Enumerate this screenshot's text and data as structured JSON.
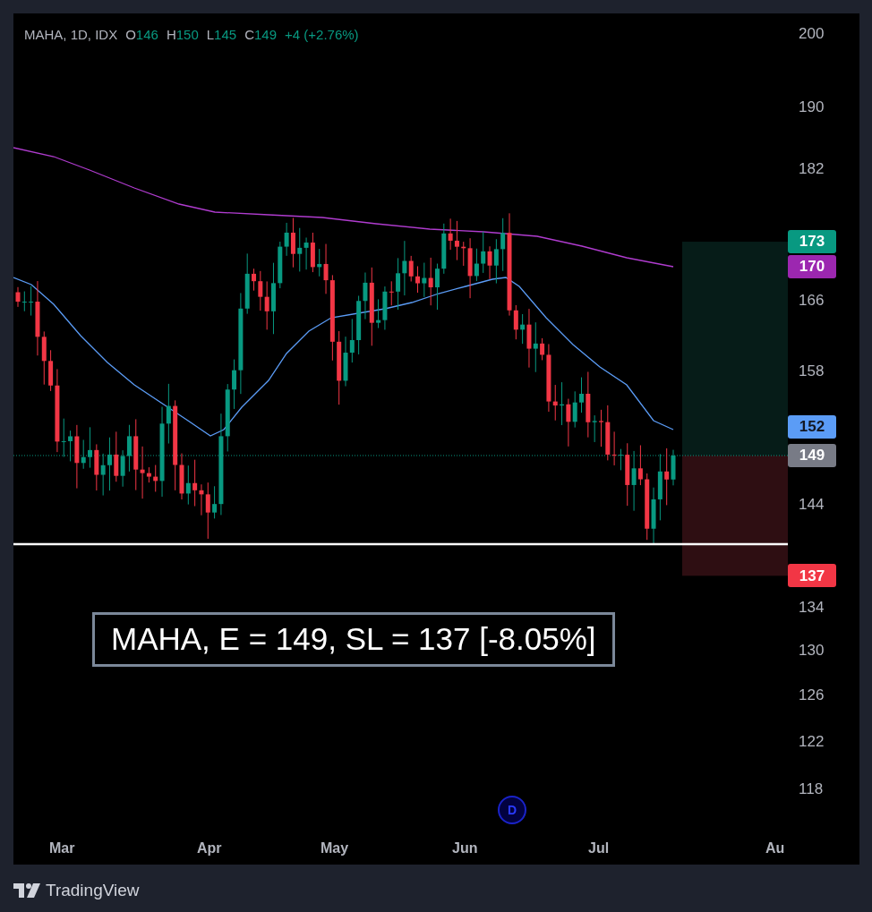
{
  "legend": {
    "symbol": "MAHA, 1D, IDX",
    "ohlc": [
      {
        "label": "O",
        "value": "146"
      },
      {
        "label": "H",
        "value": "150"
      },
      {
        "label": "L",
        "value": "145"
      },
      {
        "label": "C",
        "value": "149"
      }
    ],
    "change": "+4 (+2.76%)"
  },
  "price_axis": {
    "ticks": [
      "200",
      "190",
      "182",
      "166",
      "158",
      "144",
      "134",
      "130",
      "126",
      "122",
      "118"
    ],
    "badges": [
      {
        "value": "173",
        "color": "#089981"
      },
      {
        "value": "170",
        "color": "#9c27b0"
      },
      {
        "value": "152",
        "color": "#5b9cf6"
      },
      {
        "value": "149",
        "color": "#787b86"
      },
      {
        "value": "137",
        "color": "#f23645"
      }
    ]
  },
  "time_axis": [
    "Mar",
    "Apr",
    "May",
    "Jun",
    "Jul",
    "Au"
  ],
  "note": "MAHA, E = 149, SL = 137 [-8.05%]",
  "event_marker": "D",
  "footer": {
    "brand": "TradingView"
  }
}
